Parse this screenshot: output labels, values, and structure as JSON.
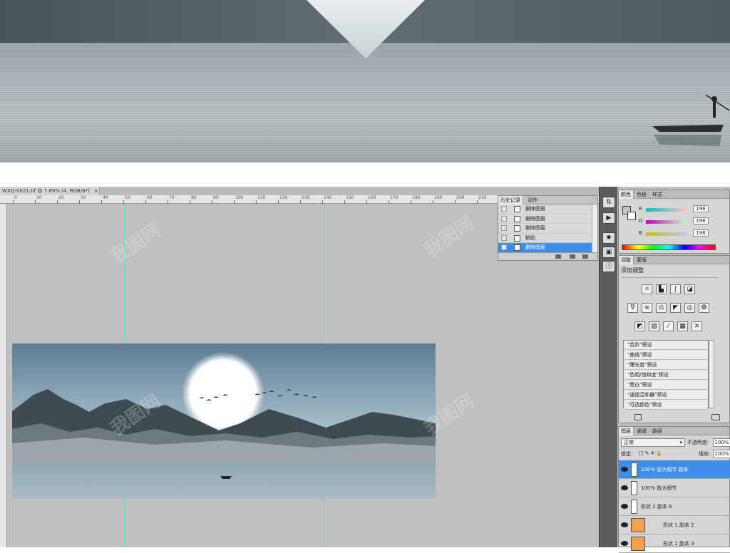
{
  "document_tab": {
    "title": "WXQ-0021.tif @ 7.89% (4, RGB/8*)",
    "close": "×"
  },
  "ruler_labels": [
    "0",
    "10",
    "20",
    "30",
    "40",
    "50",
    "60",
    "70",
    "80",
    "90",
    "100",
    "110",
    "120",
    "130",
    "140",
    "150",
    "160",
    "170",
    "180",
    "190",
    "200",
    "210"
  ],
  "history": {
    "tabs": [
      "历史记录",
      "动作"
    ],
    "rows": [
      "删除图层",
      "删除图层",
      "删除图层",
      "粘贴",
      "删除图层"
    ],
    "selected_index": 4
  },
  "color_panel": {
    "tabs": [
      "颜色",
      "色板",
      "样式"
    ],
    "channels": [
      {
        "label": "R",
        "value": "196"
      },
      {
        "label": "G",
        "value": "196"
      },
      {
        "label": "B",
        "value": "196"
      }
    ]
  },
  "adjust_panel": {
    "tabs": [
      "调整",
      "蒙版"
    ],
    "title": "添加调整",
    "presets": [
      "\"色阶\"预设",
      "\"曲线\"预设",
      "\"曝光度\"预设",
      "\"色相/饱和度\"预设",
      "\"黑白\"预设",
      "\"通道混和器\"预设",
      "\"可选颜色\"预设"
    ]
  },
  "layers_panel": {
    "tabs": [
      "图层",
      "通道",
      "路径"
    ],
    "blend_mode": "正常",
    "opacity_label": "不透明度:",
    "opacity_value": "100%",
    "lock_label": "锁定:",
    "fill_label": "填充:",
    "fill_value": "100%",
    "layers": [
      {
        "name": "100% 放大细节 副本",
        "selected": true,
        "kind": "white"
      },
      {
        "name": "100% 放大细节",
        "selected": false,
        "kind": "white"
      },
      {
        "name": "形状 2 副本 6",
        "selected": false,
        "kind": "white"
      },
      {
        "name": "形状 1 副本 2",
        "selected": false,
        "kind": "orange"
      },
      {
        "name": "形状 1 副本 3",
        "selected": false,
        "kind": "orange"
      }
    ]
  },
  "watermark": "我图网",
  "colors": {
    "accent": "#3d8ee8",
    "guide": "#5fd3e0",
    "canvas_bg": "#bfbfbf",
    "layer_orange": "#f2a04a"
  }
}
